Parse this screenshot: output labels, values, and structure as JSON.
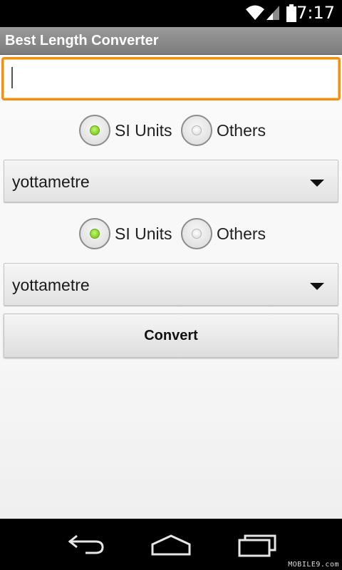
{
  "status_bar": {
    "time": "7:17",
    "icons": [
      "wifi-icon",
      "signal-icon",
      "battery-icon"
    ]
  },
  "app": {
    "title": "Best Length Converter"
  },
  "input": {
    "value": "",
    "placeholder": ""
  },
  "from": {
    "radio_options": [
      {
        "label": "SI Units",
        "selected": true
      },
      {
        "label": "Others",
        "selected": false
      }
    ],
    "unit_selected": "yottametre"
  },
  "to": {
    "radio_options": [
      {
        "label": "SI Units",
        "selected": true
      },
      {
        "label": "Others",
        "selected": false
      }
    ],
    "unit_selected": "yottametre"
  },
  "actions": {
    "convert_label": "Convert"
  },
  "nav_bar": {
    "buttons": [
      "back-icon",
      "home-icon",
      "recent-apps-icon"
    ]
  },
  "watermark": "MOBILE9.com",
  "colors": {
    "accent_focus": "#f0910f",
    "radio_selected": "#7fcf1e",
    "title_bar": "#8a8a8a"
  }
}
